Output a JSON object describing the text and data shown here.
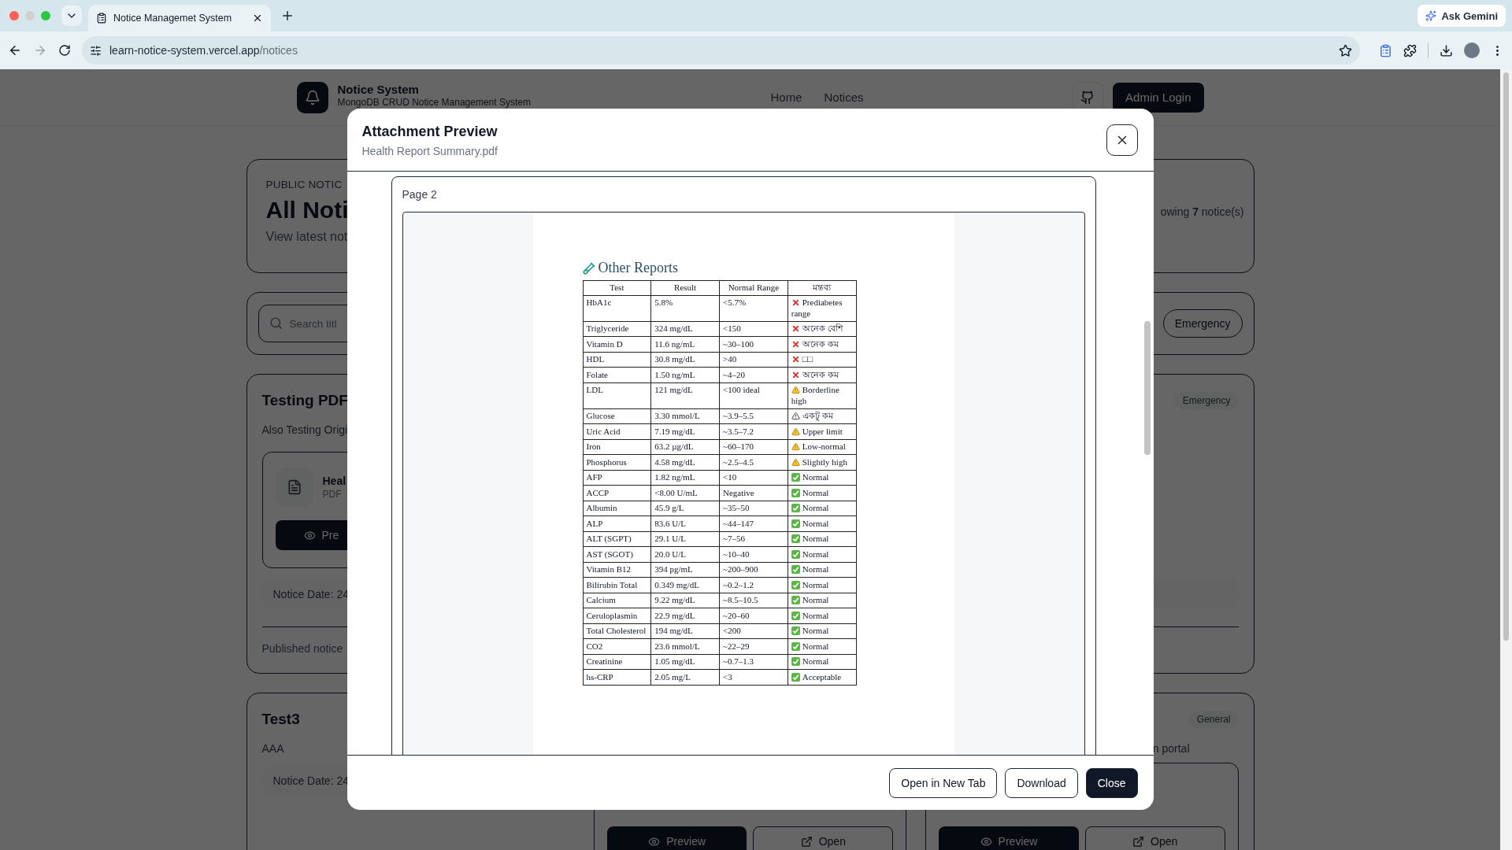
{
  "browser": {
    "tab_title": "Notice Managemet System",
    "gemini": "Ask Gemini",
    "url_host": "learn-notice-system.vercel.app",
    "url_path": "/notices"
  },
  "header": {
    "brand": "Notice System",
    "tagline": "MongoDB CRUD Notice Management System",
    "nav": [
      {
        "label": "Home"
      },
      {
        "label": "Notices"
      }
    ],
    "admin": "Admin Login"
  },
  "hero": {
    "eyebrow": "PUBLIC NOTIC",
    "title": "All Noti",
    "subtitle": "View latest not",
    "count": "owing **7** notice(s)"
  },
  "filters": {
    "search_placeholder": "Search titl",
    "category": "Emergency"
  },
  "notices": [
    {
      "title": "Testing PDF",
      "badge": "Emergency",
      "description": "Also Testing Origi",
      "attachment": {
        "name": "Heal",
        "type": "PDF",
        "preview": "Pre"
      },
      "date": "Notice Date: 24",
      "footer": "Published notice"
    },
    {
      "title": "Test3",
      "badge": "General",
      "description": "AAA",
      "aside": "n portal",
      "date": "Notice Date: 24",
      "attachments": [
        {
          "preview": "Preview",
          "open": "Open"
        },
        {
          "preview": "Preview",
          "open": "Open"
        }
      ]
    }
  ],
  "modal": {
    "title": "Attachment Preview",
    "filename": "Health Report Summary.pdf",
    "page_label": "Page 2",
    "document": {
      "heading": "Other Reports",
      "columns": [
        "Test",
        "Result",
        "Normal Range",
        "মন্তব্য"
      ],
      "rows": [
        {
          "test": "HbA1c",
          "result": "5.8%",
          "range": "<5.7%",
          "remark": {
            "kind": "bad",
            "text": "Prediabetes range"
          }
        },
        {
          "test": "Triglyceride",
          "result": "324 mg/dL",
          "range": "<150",
          "remark": {
            "kind": "bad",
            "text": "অনেক বেশি"
          }
        },
        {
          "test": "Vitamin D",
          "result": "11.6 ng/mL",
          "range": "~30–100",
          "remark": {
            "kind": "bad",
            "text": "অনেক কম"
          }
        },
        {
          "test": "HDL",
          "result": "30.8 mg/dL",
          "range": ">40",
          "remark": {
            "kind": "bad",
            "text": "□□"
          }
        },
        {
          "test": "Folate",
          "result": "1.50 ng/mL",
          "range": "~4–20",
          "remark": {
            "kind": "bad",
            "text": "অনেক কম"
          }
        },
        {
          "test": "LDL",
          "result": "121 mg/dL",
          "range": "<100 ideal",
          "remark": {
            "kind": "warn",
            "text": "Borderline high"
          }
        },
        {
          "test": "Glucose",
          "result": "3.30 mmol/L",
          "range": "~3.9–5.5",
          "remark": {
            "kind": "caution",
            "text": "একটু কম"
          }
        },
        {
          "test": "Uric Acid",
          "result": "7.19 mg/dL",
          "range": "~3.5–7.2",
          "remark": {
            "kind": "warn",
            "text": "Upper limit"
          }
        },
        {
          "test": "Iron",
          "result": "63.2 µg/dL",
          "range": "~60–170",
          "remark": {
            "kind": "warn",
            "text": "Low-normal"
          }
        },
        {
          "test": "Phosphorus",
          "result": "4.58 mg/dL",
          "range": "~2.5–4.5",
          "remark": {
            "kind": "warn",
            "text": "Slightly high"
          }
        },
        {
          "test": "AFP",
          "result": "1.82 ng/mL",
          "range": "<10",
          "remark": {
            "kind": "ok",
            "text": "Normal"
          }
        },
        {
          "test": "ACCP",
          "result": "<8.00 U/mL",
          "range": "Negative",
          "remark": {
            "kind": "ok",
            "text": "Normal"
          }
        },
        {
          "test": "Albumin",
          "result": "45.9 g/L",
          "range": "~35–50",
          "remark": {
            "kind": "ok",
            "text": "Normal"
          }
        },
        {
          "test": "ALP",
          "result": "83.6 U/L",
          "range": "~44–147",
          "remark": {
            "kind": "ok",
            "text": "Normal"
          }
        },
        {
          "test": "ALT (SGPT)",
          "result": "29.1 U/L",
          "range": "~7–56",
          "remark": {
            "kind": "ok",
            "text": "Normal"
          }
        },
        {
          "test": "AST (SGOT)",
          "result": "20.0 U/L",
          "range": "~10–40",
          "remark": {
            "kind": "ok",
            "text": "Normal"
          }
        },
        {
          "test": "Vitamin B12",
          "result": "394 pg/mL",
          "range": "~200–900",
          "remark": {
            "kind": "ok",
            "text": "Normal"
          }
        },
        {
          "test": "Bilirubin Total",
          "result": "0.349 mg/dL",
          "range": "~0.2–1.2",
          "remark": {
            "kind": "ok",
            "text": "Normal"
          }
        },
        {
          "test": "Calcium",
          "result": "9.22 mg/dL",
          "range": "~8.5–10.5",
          "remark": {
            "kind": "ok",
            "text": "Normal"
          }
        },
        {
          "test": "Ceruloplasmin",
          "result": "22.9 mg/dL",
          "range": "~20–60",
          "remark": {
            "kind": "ok",
            "text": "Normal"
          }
        },
        {
          "test": "Total Cholesterol",
          "result": "194 mg/dL",
          "range": "<200",
          "remark": {
            "kind": "ok",
            "text": "Normal"
          }
        },
        {
          "test": "CO2",
          "result": "23.6 mmol/L",
          "range": "~22–29",
          "remark": {
            "kind": "ok",
            "text": "Normal"
          }
        },
        {
          "test": "Creatinine",
          "result": "1.05 mg/dL",
          "range": "~0.7–1.3",
          "remark": {
            "kind": "ok",
            "text": "Normal"
          }
        },
        {
          "test": "hs-CRP",
          "result": "2.05 mg/L",
          "range": "<3",
          "remark": {
            "kind": "ok",
            "text": "Acceptable"
          }
        }
      ]
    },
    "buttons": [
      {
        "label": "Open in New Tab",
        "kind": "outline"
      },
      {
        "label": "Download",
        "kind": "outline"
      },
      {
        "label": "Close",
        "kind": "primary"
      }
    ]
  }
}
